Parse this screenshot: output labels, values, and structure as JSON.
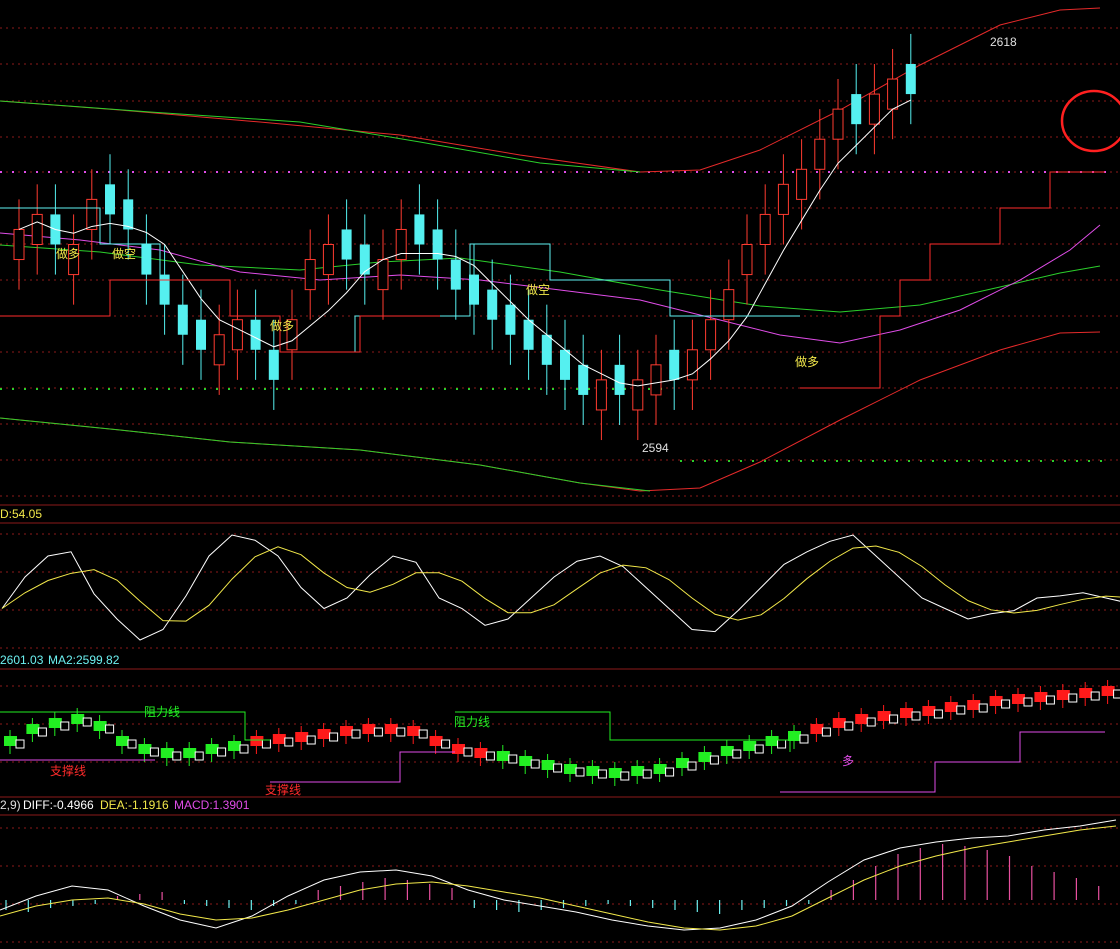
{
  "colors": {
    "background": "#000000",
    "grid": "#8b1a1a",
    "up": "#ff3b30",
    "down": "#55f0f0",
    "ma_white": "#ffffff",
    "ma_magenta": "#e04de8",
    "band_red": "#e52a2a",
    "band_green": "#2bcf2b",
    "stop_red": "#ff2b2b",
    "stop_cyan": "#5ff2f2",
    "yellow": "#f2e84a",
    "kdj_white": "#ffffff",
    "macd_pink": "#e8509f",
    "macd_cyan": "#6cf0f0",
    "box_red": "#ff1a1a",
    "box_green": "#22ee22",
    "box_white": "#ffffff",
    "circle": "#ff2020"
  },
  "annotations": {
    "high_label": "2618",
    "low_label": "2594",
    "signals": [
      "做多",
      "做空",
      "做多",
      "做空",
      "做多"
    ]
  },
  "panel2": {
    "header": "D:54.05"
  },
  "panel3": {
    "header_a": "2601.03",
    "header_b": "MA2:2599.82",
    "resistance_1": "阻力线",
    "resistance_2": "阻力线",
    "support_1": "支撑线",
    "support_2": "支撑线",
    "tag": "多"
  },
  "panel4": {
    "header_prefix": "2,9)",
    "diff": "DIFF:-0.4966",
    "dea": "DEA:-1.1916",
    "macd": "MACD:1.3901"
  },
  "chart_data": [
    {
      "type": "candlestick",
      "high": 2618,
      "low": 2594,
      "closes_approx": [
        2607,
        2608,
        2606,
        2606,
        2609,
        2608,
        2607,
        2604,
        2602,
        2600,
        2599,
        2600,
        2601,
        2599,
        2597,
        2601,
        2605,
        2606,
        2605,
        2604,
        2605,
        2607,
        2606,
        2605,
        2603,
        2602,
        2601,
        2600,
        2599,
        2598,
        2597,
        2596,
        2597,
        2596,
        2597,
        2598,
        2597,
        2599,
        2601,
        2603,
        2606,
        2608,
        2610,
        2611,
        2613,
        2615,
        2614,
        2616,
        2617,
        2616
      ]
    },
    {
      "type": "line",
      "name": "D",
      "last_value": 54.05
    },
    {
      "type": "line",
      "series": [
        {
          "name": "MA2",
          "last_value": 2599.82
        }
      ],
      "other_value": 2601.03
    },
    {
      "type": "bar",
      "series": [
        {
          "name": "DIFF",
          "last_value": -0.4966
        },
        {
          "name": "DEA",
          "last_value": -1.1916
        },
        {
          "name": "MACD",
          "last_value": 1.3901
        }
      ]
    }
  ]
}
